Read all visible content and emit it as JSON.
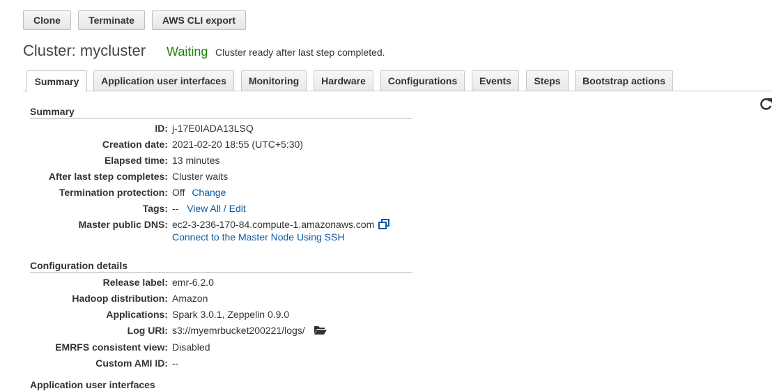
{
  "toolbar": {
    "clone_label": "Clone",
    "terminate_label": "Terminate",
    "cli_export_label": "AWS CLI export"
  },
  "cluster": {
    "title": "Cluster: mycluster",
    "status": "Waiting",
    "status_description": "Cluster ready after last step completed."
  },
  "tabs": [
    {
      "label": "Summary",
      "active": true
    },
    {
      "label": "Application user interfaces"
    },
    {
      "label": "Monitoring"
    },
    {
      "label": "Hardware"
    },
    {
      "label": "Configurations"
    },
    {
      "label": "Events"
    },
    {
      "label": "Steps"
    },
    {
      "label": "Bootstrap actions"
    }
  ],
  "summary": {
    "title": "Summary",
    "id_label": "ID:",
    "id_value": "j-17E0IADA13LSQ",
    "creation_label": "Creation date:",
    "creation_value": "2021-02-20 18:55 (UTC+5:30)",
    "elapsed_label": "Elapsed time:",
    "elapsed_value": "13 minutes",
    "after_step_label": "After last step completes:",
    "after_step_value": "Cluster waits",
    "termination_label": "Termination protection:",
    "termination_value": "Off",
    "termination_link": "Change",
    "tags_label": "Tags:",
    "tags_value": "--",
    "tags_link": "View All / Edit",
    "dns_label": "Master public DNS:",
    "dns_value": "ec2-3-236-170-84.compute-1.amazonaws.com",
    "ssh_link": "Connect to the Master Node Using SSH"
  },
  "configuration": {
    "title": "Configuration details",
    "release_label": "Release label:",
    "release_value": "emr-6.2.0",
    "hadoop_label": "Hadoop distribution:",
    "hadoop_value": "Amazon",
    "apps_label": "Applications:",
    "apps_value": "Spark 3.0.1, Zeppelin 0.9.0",
    "log_label": "Log URI:",
    "log_value": "s3://myemrbucket200221/logs/",
    "emrfs_label": "EMRFS consistent view:",
    "emrfs_value": "Disabled",
    "ami_label": "Custom AMI ID:",
    "ami_value": "--"
  },
  "next_section_title": "Application user interfaces",
  "colors": {
    "status_green": "#1d8102",
    "link_blue": "#0a5aa5"
  },
  "icons": [
    "copy-icon",
    "folder-open-icon",
    "refresh-icon"
  ]
}
